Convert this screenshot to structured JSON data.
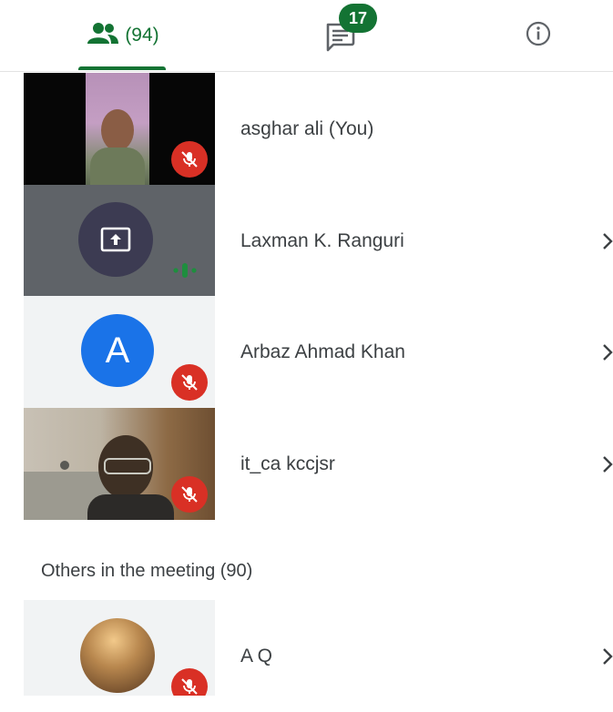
{
  "tabs": {
    "people_count": "(94)",
    "chat_badge": "17"
  },
  "participants": [
    {
      "name": "asghar ali (You)"
    },
    {
      "name": "Laxman K. Ranguri"
    },
    {
      "name": "Arbaz Ahmad Khan",
      "avatar_letter": "A"
    },
    {
      "name": "it_ca kccjsr"
    }
  ],
  "others": {
    "title": "Others in the meeting (90)",
    "participants": [
      {
        "name": "A Q"
      }
    ]
  },
  "colors": {
    "accent": "#137333",
    "mic_off": "#d93025",
    "avatar_blue": "#1a73e8"
  },
  "icons": {
    "people": "people-icon",
    "chat": "chat-icon",
    "info": "info-icon",
    "mic_off": "mic-off-icon",
    "chevron": "chevron-right-icon"
  }
}
